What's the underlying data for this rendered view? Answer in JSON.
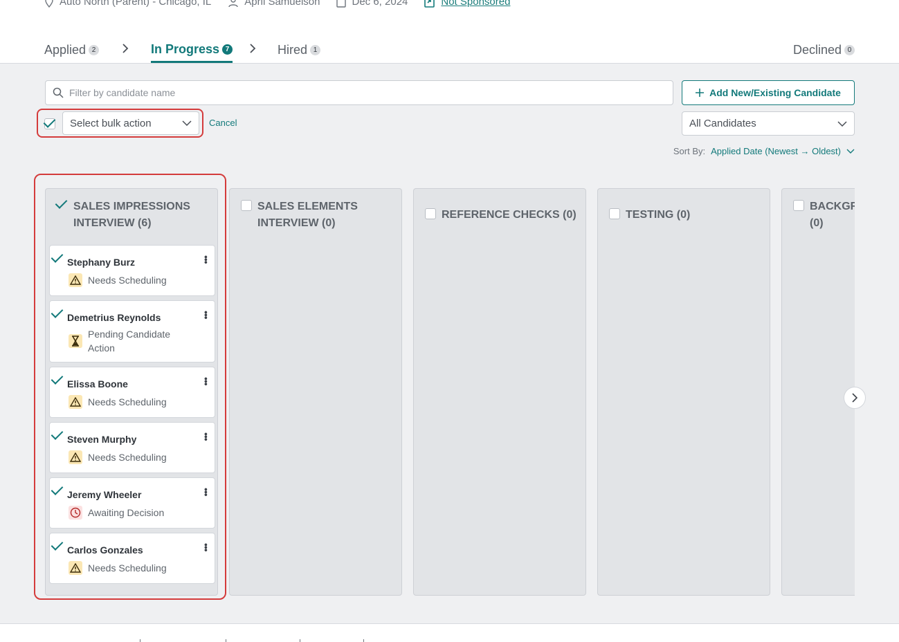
{
  "meta": {
    "location": "Auto North (Parent) - Chicago, IL",
    "owner": "April Samuelson",
    "date": "Dec 6, 2024",
    "sponsorship": "Not Sponsored"
  },
  "tabs": [
    {
      "label": "Applied",
      "count": "2"
    },
    {
      "label": "In Progress",
      "count": "7"
    },
    {
      "label": "Hired",
      "count": "1"
    },
    {
      "label": "Declined",
      "count": "0"
    }
  ],
  "search": {
    "placeholder": "Filter by candidate name"
  },
  "add_button": "Add New/Existing Candidate",
  "bulk": {
    "select_label": "Select bulk action",
    "cancel": "Cancel"
  },
  "candidate_filter": "All Candidates",
  "sort": {
    "label": "Sort By:",
    "value": "Applied Date (Newest → Oldest)"
  },
  "columns": [
    {
      "title": "SALES IMPRESSIONS INTERVIEW (6)",
      "checked": true
    },
    {
      "title": "SALES ELEMENTS INTERVIEW (0)",
      "checked": false
    },
    {
      "title": "REFERENCE CHECKS (0)",
      "checked": false
    },
    {
      "title": "TESTING (0)",
      "checked": false
    },
    {
      "title": "BACKGR (0)",
      "checked": false
    }
  ],
  "cards": [
    {
      "name": "Stephany Burz",
      "status": "Needs Scheduling",
      "icon": "warning-icon"
    },
    {
      "name": "Demetrius Reynolds",
      "status": "Pending Candidate Action",
      "icon": "hourglass-icon"
    },
    {
      "name": "Elissa Boone",
      "status": "Needs Scheduling",
      "icon": "warning-icon"
    },
    {
      "name": "Steven Murphy",
      "status": "Needs Scheduling",
      "icon": "warning-icon"
    },
    {
      "name": "Jeremy Wheeler",
      "status": "Awaiting Decision",
      "icon": "clock-icon"
    },
    {
      "name": "Carlos Gonzales",
      "status": "Needs Scheduling",
      "icon": "warning-icon"
    }
  ],
  "colors": {
    "accent": "#12797a",
    "highlight": "#d43b3b",
    "warning_bg": "#fbe7b4",
    "waiting_bg": "#fbe1e1"
  }
}
